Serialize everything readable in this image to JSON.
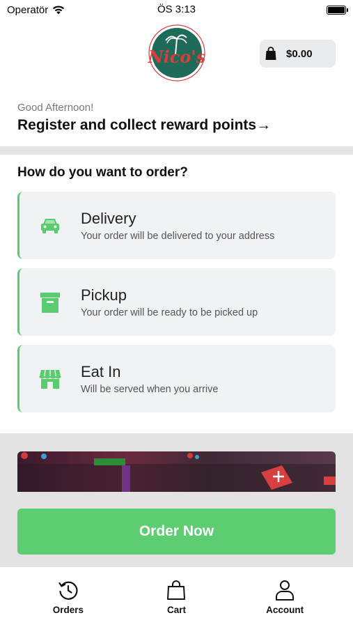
{
  "status_bar": {
    "carrier": "Operatör",
    "time": "ÖS 3:13"
  },
  "header": {
    "logo_icon": "nicos-pizza-logo",
    "logo_text": "Nico's",
    "cart_icon": "shopping-bag-icon",
    "cart_amount": "$0.00"
  },
  "greeting": {
    "salutation": "Good Afternoon!",
    "register_link": "Register and collect reward points→"
  },
  "order_section": {
    "heading": "How do you want to order?",
    "accent_color": "#58cc6e",
    "options": [
      {
        "icon": "car-icon",
        "title": "Delivery",
        "subtitle": "Your order will be delivered to your address"
      },
      {
        "icon": "box-icon",
        "title": "Pickup",
        "subtitle": "Your order will be ready to be picked up"
      },
      {
        "icon": "storefront-icon",
        "title": "Eat In",
        "subtitle": "Will be served when you arrive"
      }
    ]
  },
  "promo": {
    "image": "restaurant-interior-photo"
  },
  "cta": {
    "label": "Order Now",
    "color": "#5ccd71"
  },
  "tabbar": {
    "tabs": [
      {
        "icon": "history-icon",
        "label": "Orders"
      },
      {
        "icon": "bag-icon",
        "label": "Cart"
      },
      {
        "icon": "person-icon",
        "label": "Account"
      }
    ]
  }
}
